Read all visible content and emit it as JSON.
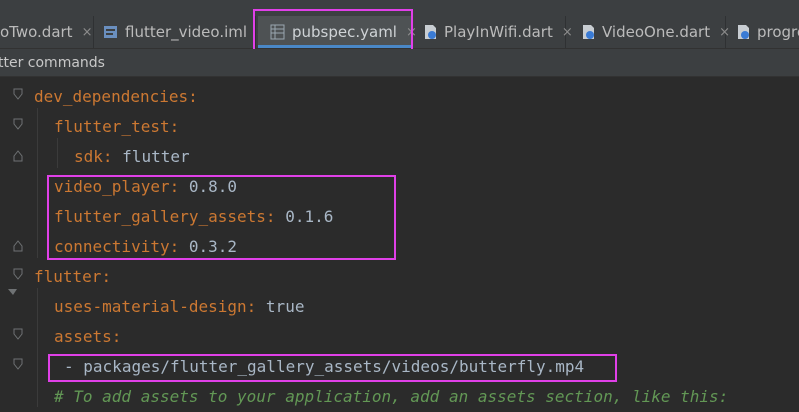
{
  "tabs": [
    {
      "label": "oTwo.dart",
      "icon": "none",
      "close": "×"
    },
    {
      "label": "flutter_video.iml",
      "icon": "module-file-icon",
      "close": "×"
    },
    {
      "label": "pubspec.yaml",
      "icon": "yaml-file-icon",
      "close": "×",
      "active": true
    },
    {
      "label": "PlayInWifi.dart",
      "icon": "dart-file-icon",
      "close": "×"
    },
    {
      "label": "VideoOne.dart",
      "icon": "dart-file-icon",
      "close": "×"
    },
    {
      "label": "progre",
      "icon": "dart-file-icon",
      "close": ""
    }
  ],
  "notification": {
    "text": "tter commands"
  },
  "code": {
    "l1_key": "dev_dependencies",
    "l2_key": "flutter_test",
    "l3_key": "sdk",
    "l3_val": "flutter",
    "l4_key": "video_player",
    "l4_val": "0.8.0",
    "l5_key": "flutter_gallery_assets",
    "l5_val": "0.1.6",
    "l6_key": "connectivity",
    "l6_val": "0.3.2",
    "l7_key": "flutter",
    "l8_key": "uses-material-design",
    "l8_val": "true",
    "l9_key": "assets",
    "l10_dash": "-",
    "l10_val": "packages/flutter_gallery_assets/videos/butterfly.mp4",
    "l11_comment": "# To add assets to your application, add an assets section, like this:"
  },
  "colors": {
    "highlight": "#e040e8",
    "key": "#cc7832",
    "value": "#a9b7c6",
    "comment": "#629755"
  }
}
